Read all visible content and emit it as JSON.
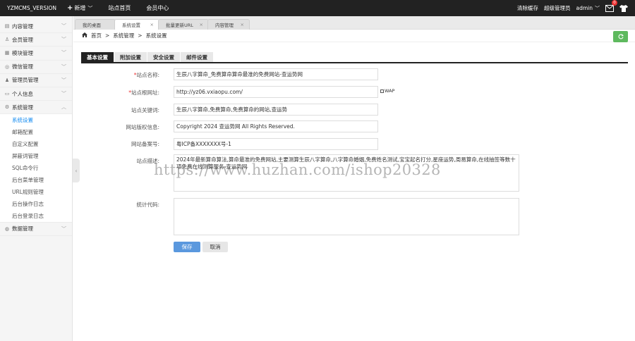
{
  "topbar": {
    "brand": "YZMCMS_VERSION",
    "add_label": "新增",
    "site_home": "站点首页",
    "member_center": "会员中心",
    "clear_cache": "清除缓存",
    "role": "超级管理员",
    "username": "admin",
    "message_count": "0"
  },
  "sidebar": {
    "items": [
      {
        "label": "内容管理"
      },
      {
        "label": "会员管理"
      },
      {
        "label": "模块管理"
      },
      {
        "label": "微信管理"
      },
      {
        "label": "管理员管理"
      },
      {
        "label": "个人信息"
      },
      {
        "label": "系统管理"
      }
    ],
    "sub_items": [
      {
        "label": "系统设置"
      },
      {
        "label": "邮箱配置"
      },
      {
        "label": "自定义配置"
      },
      {
        "label": "屏蔽词管理"
      },
      {
        "label": "SQL命令行"
      },
      {
        "label": "后台菜单管理"
      },
      {
        "label": "URL规则管理"
      },
      {
        "label": "后台操作日志"
      },
      {
        "label": "后台登录日志"
      }
    ],
    "last_item": {
      "label": "数据管理"
    }
  },
  "tabs": [
    {
      "label": "我的桌面"
    },
    {
      "label": "系统设置"
    },
    {
      "label": "批量更新URL"
    },
    {
      "label": "内容管理"
    }
  ],
  "breadcrumb": {
    "home": "首页",
    "sep": ">",
    "level1": "系统管理",
    "level2": "系统设置"
  },
  "form_tabs": [
    {
      "label": "基本设置"
    },
    {
      "label": "附加设置"
    },
    {
      "label": "安全设置"
    },
    {
      "label": "邮件设置"
    }
  ],
  "form": {
    "site_name_label": "站点名称:",
    "site_name": "生辰八字算命_免费算命算命最准的免费网站-查运势网",
    "site_url_label": "站点根网址:",
    "site_url": "http://yz06.vxiaopu.com/",
    "wap_label": "WAP",
    "keywords_label": "站点关键词:",
    "keywords": "生辰八字算命,免费算命,免费算命的网站,查运势",
    "copyright_label": "网站版权信息:",
    "copyright": "Copyright 2024 查运势网 All Rights Reserved.",
    "icp_label": "网站备案号:",
    "icp": "粤ICP备XXXXXXX号-1",
    "desc_label": "站点描述:",
    "description": "2024年最新算命算法,算命最准的免费网站,主要测算生辰八字算命,八字算命婚姻,免费姓名测试,宝宝起名打分,星座运势,周易算命,在线抽签等数十项免费在线测算服务-查运势网",
    "stats_label": "统计代码:",
    "stats_code": "",
    "save_label": "保存",
    "cancel_label": "取消"
  },
  "watermark": "https://www.huzhan.com/ishop20328",
  "colors": {
    "topbar_bg": "#222222",
    "accent": "#148cf1",
    "save_button": "#5a98de",
    "refresh_button": "#5eb95e",
    "required": "#ee3333"
  }
}
